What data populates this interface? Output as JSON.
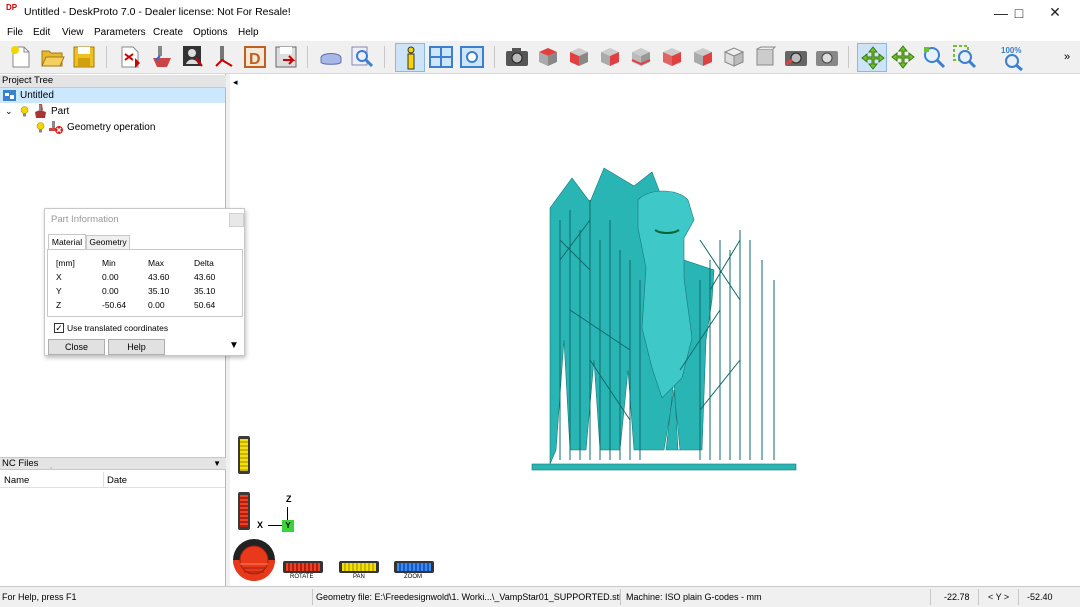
{
  "window": {
    "title": "Untitled - DeskProto 7.0 - Dealer license: Not For Resale!",
    "app_icon_text": "DP"
  },
  "menu": [
    "File",
    "Edit",
    "View",
    "Parameters",
    "Create",
    "Options",
    "Help"
  ],
  "toolbar": {
    "icons": [
      "new-project",
      "open-project",
      "save-project",
      "import-geometry",
      "part-operation",
      "vector-operation",
      "bitmap-operation",
      "drill-operation",
      "save-nc",
      "part-wizard",
      "preview",
      "part-information",
      "split-view",
      "camera-view",
      "screenshot-view",
      "view-top",
      "view-front",
      "view-right",
      "view-back",
      "view-left",
      "view-bottom",
      "view-iso",
      "view-iso-2",
      "rotate-tool",
      "pan-tool",
      "zoom-in-tool",
      "zoom-window-tool",
      "zoom-100"
    ],
    "zoom_label": "100%",
    "more": "»"
  },
  "project_tree": {
    "header": "Project Tree",
    "root": "Untitled",
    "part": "Part",
    "operation": "Geometry operation"
  },
  "part_information": {
    "title": "Part Information",
    "tabs": [
      "Material",
      "Geometry"
    ],
    "headers": [
      "[mm]",
      "Min",
      "Max",
      "Delta"
    ],
    "rows": [
      {
        "axis": "X",
        "min": "0.00",
        "max": "43.60",
        "delta": "43.60"
      },
      {
        "axis": "Y",
        "min": "0.00",
        "max": "35.10",
        "delta": "35.10"
      },
      {
        "axis": "Z",
        "min": "-50.64",
        "max": "0.00",
        "delta": "50.64"
      }
    ],
    "checkbox_label": "Use translated coordinates",
    "checkbox_checked": true,
    "close_label": "Close",
    "help_label": "Help"
  },
  "nc_files": {
    "header": "NC Files",
    "columns": [
      "Name",
      "Date"
    ]
  },
  "viewport": {
    "model_color": "#2ab5b5",
    "axis_labels": {
      "z": "Z",
      "x": "X",
      "y": "Y"
    },
    "controls": [
      "ROTATE",
      "PAN",
      "ZOOM"
    ],
    "collapse_arrow": "◂"
  },
  "status": {
    "help": "For Help, press F1",
    "geometry_file": "Geometry file: E:\\Freedesignwold\\1. Worki...\\_VampStar01_SUPPORTED.stl",
    "machine": "Machine: ISO plain G-codes - mm",
    "coord1": "-22.78",
    "axis_mode": "< Y >",
    "coord2": "-52.40"
  }
}
